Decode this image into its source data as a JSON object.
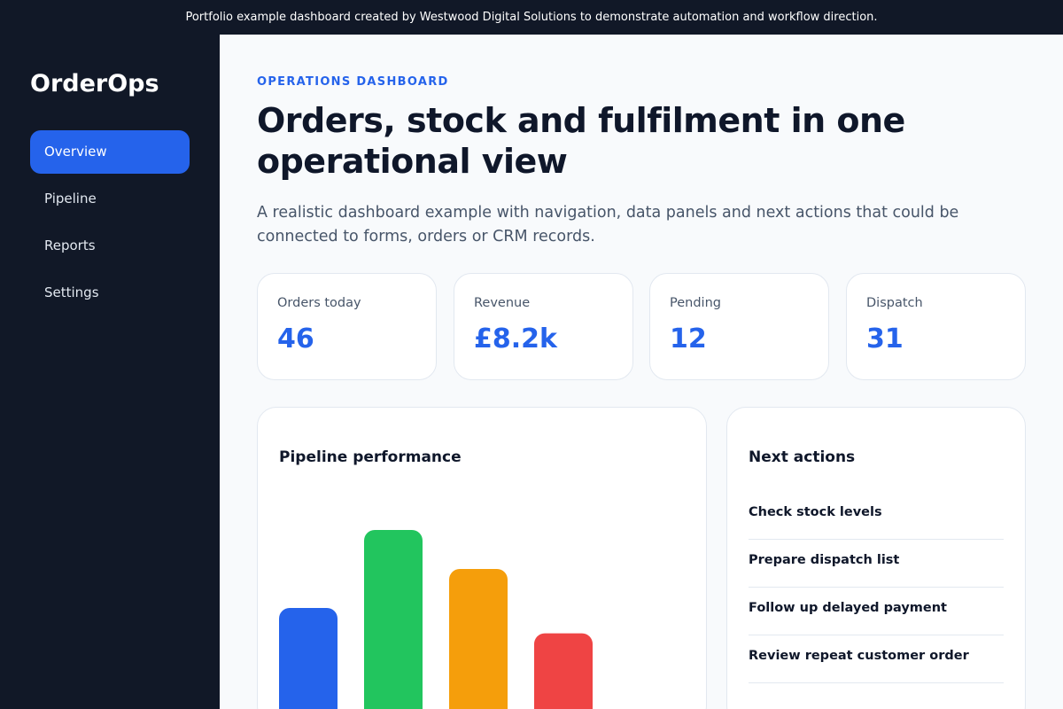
{
  "banner": {
    "text": "Portfolio example dashboard created by Westwood Digital Solutions to demonstrate automation and workflow direction."
  },
  "sidebar": {
    "brand": "OrderOps",
    "items": [
      {
        "label": "Overview",
        "active": true
      },
      {
        "label": "Pipeline",
        "active": false
      },
      {
        "label": "Reports",
        "active": false
      },
      {
        "label": "Settings",
        "active": false
      }
    ]
  },
  "header": {
    "eyebrow": "OPERATIONS DASHBOARD",
    "title": "Orders, stock and fulfilment in one operational view",
    "subtitle": "A realistic dashboard example with navigation, data panels and next actions that could be connected to forms, orders or CRM records."
  },
  "stats": [
    {
      "label": "Orders today",
      "value": "46"
    },
    {
      "label": "Revenue",
      "value": "£8.2k"
    },
    {
      "label": "Pending",
      "value": "12"
    },
    {
      "label": "Dispatch",
      "value": "31"
    }
  ],
  "pipeline": {
    "title": "Pipeline performance"
  },
  "chart_data": {
    "type": "bar",
    "values": [
      60,
      100,
      80,
      47
    ],
    "colors": [
      "#2563eb",
      "#22c55e",
      "#f59e0b",
      "#ef4444"
    ],
    "ylim": [
      0,
      100
    ]
  },
  "next_actions": {
    "title": "Next actions",
    "items": [
      "Check stock levels",
      "Prepare dispatch list",
      "Follow up delayed payment",
      "Review repeat customer order"
    ]
  },
  "colors": {
    "sidebar_bg": "#111827",
    "accent": "#2563eb",
    "page_bg": "#f8fafc"
  }
}
